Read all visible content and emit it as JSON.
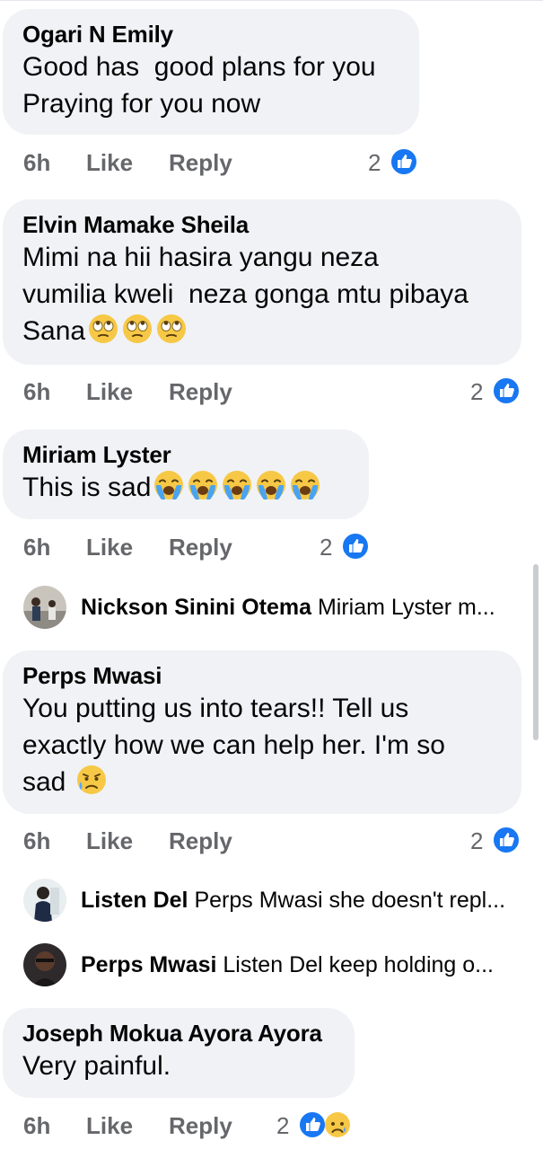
{
  "comments": [
    {
      "author": "Ogari N Emily",
      "lines": [
        "Good has  good plans for you",
        "Praying for you now"
      ],
      "time": "6h",
      "like": "Like",
      "reply": "Reply",
      "count": "2"
    },
    {
      "author": "Elvin Mamake Sheila",
      "lines": [
        "Mimi na hii hasira yangu neza",
        "vumilia kweli  neza gonga mtu pibaya",
        "Sana"
      ],
      "time": "6h",
      "like": "Like",
      "reply": "Reply",
      "count": "2"
    },
    {
      "author": "Miriam Lyster",
      "lines": [
        "This is sad"
      ],
      "time": "6h",
      "like": "Like",
      "reply": "Reply",
      "count": "2"
    },
    {
      "author": "Perps Mwasi",
      "lines": [
        "You putting us into tears!! Tell us",
        "exactly how we can help her. I'm so",
        "sad"
      ],
      "time": "6h",
      "like": "Like",
      "reply": "Reply",
      "count": "2"
    },
    {
      "author": "Joseph Mokua Ayora Ayora",
      "lines": [
        "Very painful."
      ],
      "time": "6h",
      "like": "Like",
      "reply": "Reply",
      "count": "2"
    }
  ],
  "replies": [
    {
      "author": "Nickson Sinini Otema",
      "preview": "Miriam Lyster m..."
    },
    {
      "author": "Listen Del",
      "preview": "Perps Mwasi she doesn't repl..."
    },
    {
      "author": "Perps Mwasi",
      "preview": "Listen Del keep holding o..."
    }
  ],
  "icons": {
    "like_reaction": "thumbs-up-icon",
    "sad_reaction": "sad-face-icon",
    "rolling_eyes": "face-with-rolling-eyes-emoji",
    "loudly_crying": "loudly-crying-face-emoji",
    "sad_but_relieved": "sad-but-relieved-face-emoji"
  },
  "colors": {
    "bubble": "#f0f2f5",
    "meta_text": "#65676b",
    "like_blue": "#1877f2",
    "emoji_yellow": "#f7c846"
  }
}
